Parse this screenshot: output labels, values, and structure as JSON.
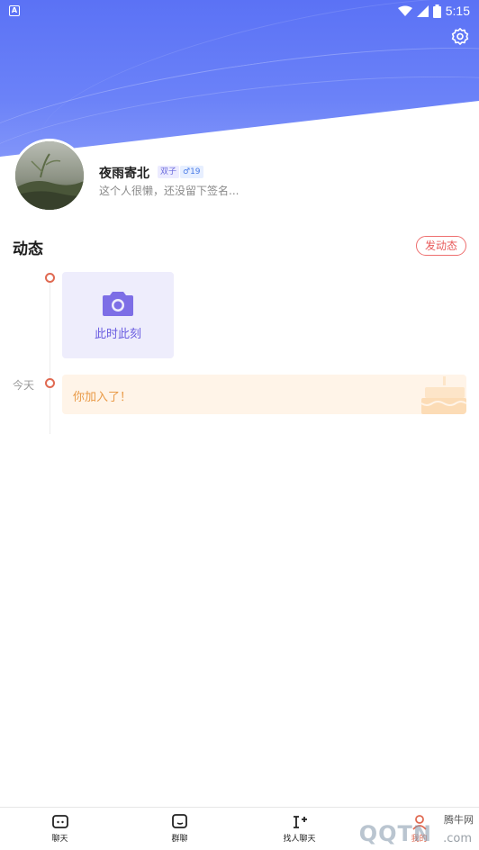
{
  "status_bar": {
    "time": "5:15",
    "left_icon": "a-notification-icon"
  },
  "profile": {
    "username": "夜雨寄北",
    "zodiac": "双子",
    "gender_age": "♂19",
    "signature": "这个人很懒，还没留下签名..."
  },
  "moments": {
    "title": "动态",
    "post_button": "发动态",
    "capture_label": "此时此刻",
    "timeline": [
      {
        "date": "今天",
        "text": "你加入了！"
      }
    ]
  },
  "bottom_nav": [
    {
      "label": "聊天",
      "icon": "chat-icon"
    },
    {
      "label": "群聊",
      "icon": "group-chat-icon"
    },
    {
      "label": "找人聊天",
      "icon": "find-people-icon"
    },
    {
      "label": "我的",
      "icon": "profile-icon"
    }
  ],
  "watermark": {
    "site": "腾牛网",
    "logo": "QQTN",
    "domain": ".com"
  },
  "colors": {
    "header_gradient_top": "#5b72f5",
    "accent_purple": "#6a5de0",
    "timeline_dot": "#e06a52",
    "post_button": "#e85a5a",
    "join_text": "#e99a47"
  }
}
